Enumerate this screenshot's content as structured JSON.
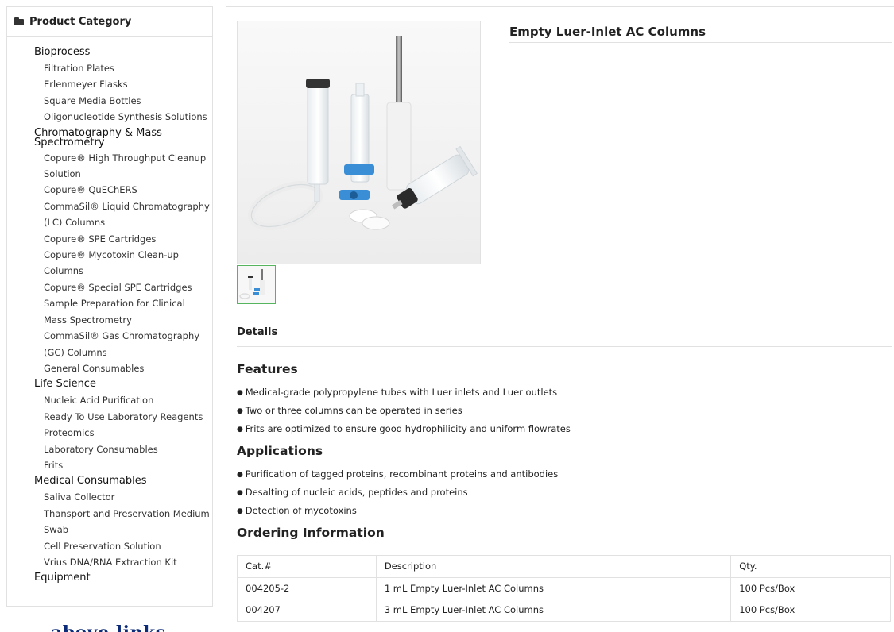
{
  "sidebar": {
    "title": "Product Category",
    "groups": [
      {
        "label": "Bioprocess",
        "items": [
          "Filtration Plates",
          "Erlenmeyer Flasks",
          "Square Media Bottles",
          "Oligonucleotide Synthesis Solutions"
        ]
      },
      {
        "label": "Chromatography & Mass Spectrometry",
        "items": [
          "Copure® High Throughput Cleanup Solution",
          "Copure® QuEChERS",
          "CommaSil® Liquid Chromatography (LC) Columns",
          "Copure® SPE Cartridges",
          "Copure® Mycotoxin Clean-up Columns",
          "Copure® Special SPE Cartridges",
          "Sample Preparation for Clinical Mass Spectrometry",
          "CommaSil® Gas Chromatography (GC) Columns",
          "General Consumables"
        ]
      },
      {
        "label": "Life Science",
        "items": [
          "Nucleic Acid Purification",
          "Ready To Use Laboratory Reagents",
          "Proteomics",
          "Laboratory Consumables",
          "Frits"
        ]
      },
      {
        "label": "Medical Consumables",
        "items": [
          "Saliva Collector",
          "Thansport and Preservation Medium",
          "Swab",
          "Cell Preservation Solution",
          "Vrius DNA/RNA Extraction Kit"
        ]
      },
      {
        "label": "Equipment",
        "items": []
      }
    ]
  },
  "footer_banner": "above links",
  "product": {
    "title": "Empty Luer-Inlet AC Columns",
    "details_label": "Details",
    "features_heading": "Features",
    "features": [
      "Medical-grade polypropylene tubes with Luer inlets and Luer outlets",
      "Two or three columns can be operated in series",
      "Frits are optimized to ensure good hydrophilicity and uniform flowrates"
    ],
    "applications_heading": "Applications",
    "applications": [
      "Purification of tagged proteins, recombinant proteins and antibodies",
      "Desalting of nucleic acids, peptides and proteins",
      "Detection of mycotoxins"
    ],
    "ordering_heading": "Ordering Information",
    "table": {
      "headers": [
        "Cat.#",
        "Description",
        "Qty."
      ],
      "rows": [
        [
          "004205-2",
          "1 mL Empty Luer-Inlet AC Columns",
          "100 Pcs/Box"
        ],
        [
          "004207",
          "3 mL Empty Luer-Inlet AC Columns",
          "100 Pcs/Box"
        ]
      ]
    }
  },
  "colors": {
    "thumb_border": "#55b55f",
    "banner_text": "#0b2a78",
    "border": "#e1e1e1",
    "blue_part": "#3a8ed6"
  }
}
